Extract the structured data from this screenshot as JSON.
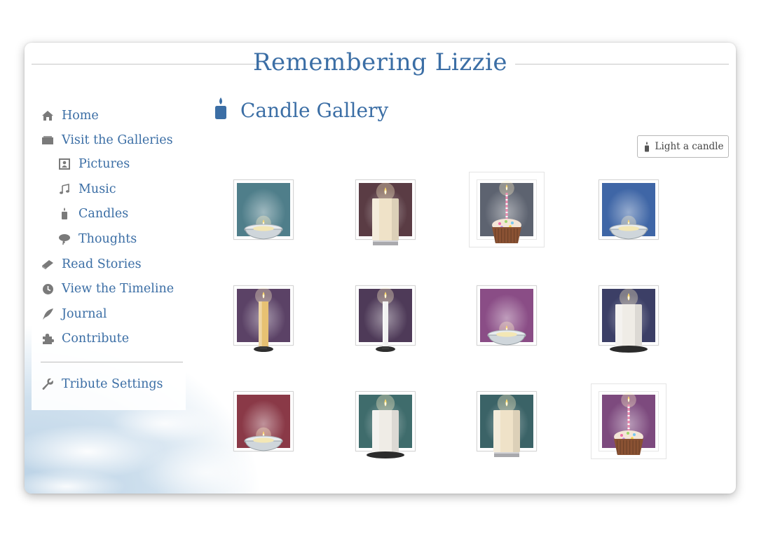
{
  "site": {
    "title": "Remembering Lizzie"
  },
  "sidebar": {
    "items": [
      {
        "label": "Home",
        "icon": "home-icon",
        "level": 0
      },
      {
        "label": "Visit the Galleries",
        "icon": "galleries-icon",
        "level": 0
      },
      {
        "label": "Pictures",
        "icon": "picture-icon",
        "level": 1
      },
      {
        "label": "Music",
        "icon": "music-note-icon",
        "level": 1
      },
      {
        "label": "Candles",
        "icon": "candle-icon",
        "level": 1
      },
      {
        "label": "Thoughts",
        "icon": "thought-bubble-icon",
        "level": 1
      },
      {
        "label": "Read Stories",
        "icon": "book-icon",
        "level": 0
      },
      {
        "label": "View the Timeline",
        "icon": "clock-icon",
        "level": 0
      },
      {
        "label": "Journal",
        "icon": "quill-icon",
        "level": 0
      },
      {
        "label": "Contribute",
        "icon": "puzzle-icon",
        "level": 0
      }
    ],
    "settings": {
      "label": "Tribute Settings",
      "icon": "wrench-icon"
    }
  },
  "gallery": {
    "title": "Candle Gallery",
    "icon": "candle-icon",
    "light_button": "Light a candle",
    "candles": [
      {
        "style": "tealight",
        "bg": "#4f7e8a"
      },
      {
        "style": "pillar-cream",
        "bg": "#5a3c44"
      },
      {
        "style": "cupcake",
        "bg": "#5d6370"
      },
      {
        "style": "tealight",
        "bg": "#3f66a6"
      },
      {
        "style": "taper-gold",
        "bg": "#5b4266"
      },
      {
        "style": "taper-white",
        "bg": "#4e3a58"
      },
      {
        "style": "tealight",
        "bg": "#8a4d86"
      },
      {
        "style": "pillar-white",
        "bg": "#3c3f66"
      },
      {
        "style": "tealight",
        "bg": "#8a3947"
      },
      {
        "style": "pillar-white",
        "bg": "#3f6c6c"
      },
      {
        "style": "pillar-cream",
        "bg": "#3b6367"
      },
      {
        "style": "cupcake",
        "bg": "#7d4a7e"
      }
    ]
  },
  "colors": {
    "accent": "#3b6ea5",
    "text_muted": "#444444"
  }
}
